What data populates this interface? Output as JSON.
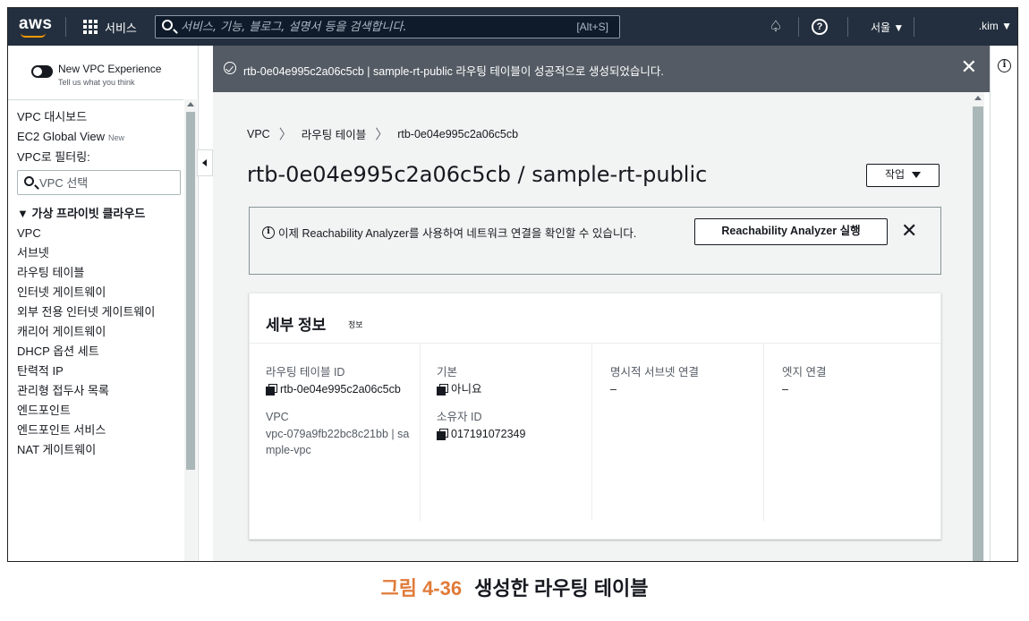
{
  "nav": {
    "logo": "aws",
    "services_label": "서비스",
    "search_placeholder": "서비스, 기능, 블로그, 설명서 등을 검색합니다.",
    "search_shortcut": "[Alt+S]",
    "region": "서울 ▼",
    "user": ".kim ▼"
  },
  "sidebar": {
    "experience_title": "New VPC Experience",
    "experience_sub": "Tell us what you think",
    "dashboard": "VPC 대시보드",
    "ec2_global_view": "EC2 Global View",
    "new_badge": "New",
    "filter_label": "VPC로 필터링:",
    "filter_placeholder": "VPC 선택",
    "section_title": "▼ 가상 프라이빗 클라우드",
    "items": [
      "VPC",
      "서브넷",
      "라우팅 테이블",
      "인터넷 게이트웨이",
      "외부 전용 인터넷 게이트웨이",
      "캐리어 게이트웨이",
      "DHCP 옵션 세트",
      "탄력적 IP",
      "관리형 접두사 목록",
      "엔드포인트",
      "엔드포인트 서비스",
      "NAT 게이트웨이"
    ]
  },
  "flash": {
    "message": "rtb-0e04e995c2a06c5cb | sample-rt-public 라우팅 테이블이 성공적으로 생성되었습니다.",
    "close": "✕"
  },
  "breadcrumb": [
    "VPC",
    "라우팅 테이블",
    "rtb-0e04e995c2a06c5cb"
  ],
  "breadcrumb_sep": "〉",
  "page": {
    "title": "rtb-0e04e995c2a06c5cb / sample-rt-public",
    "actions_label": "작업"
  },
  "alert": {
    "text": "이제 Reachability Analyzer를 사용하여 네트워크 연결을 확인할 수 있습니다.",
    "button": "Reachability Analyzer 실행",
    "close": "✕"
  },
  "details": {
    "title": "세부 정보",
    "info": "정보",
    "route_table_id_label": "라우팅 테이블 ID",
    "route_table_id": "rtb-0e04e995c2a06c5cb",
    "vpc_label": "VPC",
    "vpc_value": "vpc-079a9fb22bc8c21bb | sample-vpc",
    "default_label": "기본",
    "default_value": "아니요",
    "owner_label": "소유자 ID",
    "owner_value": "017191072349",
    "explicit_label": "명시적 서브넷 연결",
    "explicit_value": "–",
    "edge_label": "엣지 연결",
    "edge_value": "–"
  },
  "caption": {
    "number": "그림 4-36",
    "text": "생성한 라우팅 테이블"
  },
  "colors": {
    "nav_bg": "#232f3e",
    "flash_bg": "#545b64",
    "main_bg": "#f2f3f3",
    "caption_accent": "#e07b39"
  }
}
